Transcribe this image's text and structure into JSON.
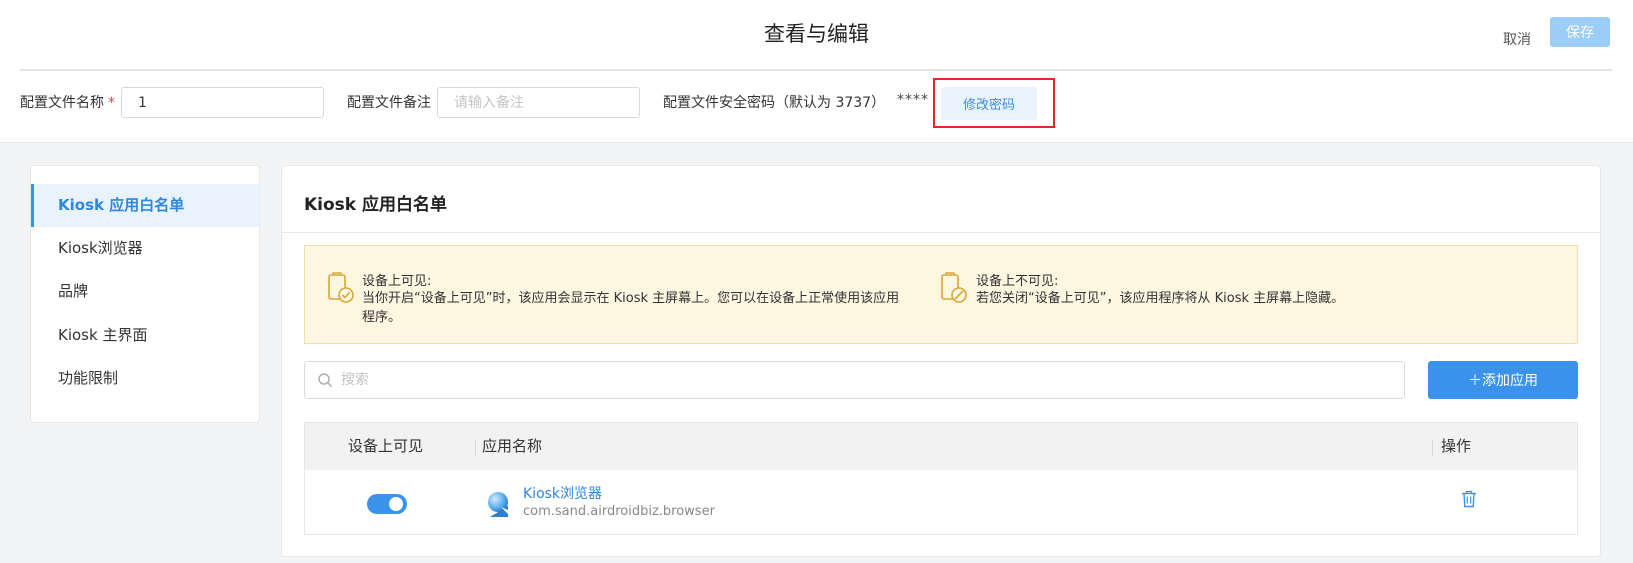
{
  "header": {
    "title": "查看与编辑",
    "cancel_label": "取消",
    "save_label": "保存"
  },
  "config": {
    "name_label": "配置文件名称",
    "required_mark": "*",
    "name_value": "1",
    "remark_label": "配置文件备注",
    "remark_placeholder": "请输入备注",
    "password_label": "配置文件安全密码（默认为 3737）",
    "password_mask": "****",
    "change_password_label": "修改密码"
  },
  "sidebar": {
    "items": [
      {
        "label": "Kiosk 应用白名单",
        "active": true
      },
      {
        "label": "Kiosk浏览器",
        "active": false
      },
      {
        "label": "品牌",
        "active": false
      },
      {
        "label": "Kiosk 主界面",
        "active": false
      },
      {
        "label": "功能限制",
        "active": false
      }
    ]
  },
  "main": {
    "title": "Kiosk 应用白名单",
    "notice": {
      "visible_title": "设备上可见:",
      "visible_text": "当你开启“设备上可见”时，该应用会显示在 Kiosk 主屏幕上。您可以在设备上正常使用该应用程序。",
      "hidden_title": "设备上不可见:",
      "hidden_text": "若您关闭“设备上可见”，该应用程序将从 Kiosk 主屏幕上隐藏。"
    },
    "search_placeholder": "搜索",
    "add_app_label": "＋添加应用",
    "table": {
      "columns": [
        "设备上可见",
        "应用名称",
        "操作"
      ],
      "rows": [
        {
          "visible": true,
          "app_name": "Kiosk浏览器",
          "package": "com.sand.airdroidbiz.browser"
        }
      ]
    }
  },
  "colors": {
    "primary": "#3a92ea",
    "save_disabled": "#9bcdf6",
    "notice_bg": "#fdf6e1",
    "highlight_border": "#e02a2a",
    "notice_icon": "#d9a63a"
  }
}
